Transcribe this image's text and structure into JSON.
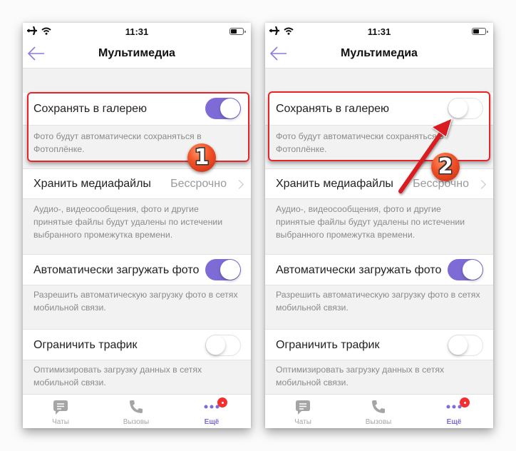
{
  "screens": [
    {
      "status": {
        "time": "11:31"
      },
      "nav": {
        "title": "Мультимедиа"
      },
      "settings": [
        {
          "label": "Сохранять в галерею",
          "toggle": true,
          "description": "Фото будут автоматически сохраняться в Фотоплёнке."
        },
        {
          "label": "Хранить медиафайлы",
          "value": "Бессрочно",
          "description": "Аудио-, видеосообщения, фото и другие принятые файлы будут удалены по истечении выбранного промежутка времени."
        },
        {
          "label": "Автоматически загружать фото",
          "toggle": true,
          "description": "Разрешить автоматическую загрузку фото в сетях мобильной связи."
        },
        {
          "label": "Ограничить трафик",
          "toggle": false,
          "description": "Оптимизировать загрузку данных в сетях мобильной связи."
        }
      ],
      "tabs": [
        {
          "label": "Чаты",
          "icon": "chat-bubble-icon"
        },
        {
          "label": "Вызовы",
          "icon": "phone-icon"
        },
        {
          "label": "Ещё",
          "icon": "more-dots-icon",
          "active": true,
          "badge": true
        }
      ],
      "annotation": {
        "step": "1"
      }
    },
    {
      "status": {
        "time": "11:31"
      },
      "nav": {
        "title": "Мультимедиа"
      },
      "settings": [
        {
          "label": "Сохранять в галерею",
          "toggle": false,
          "description": "Фото будут автоматически сохраняться в Фотоплёнке."
        },
        {
          "label": "Хранить медиафайлы",
          "value": "Бессрочно",
          "description": "Аудио-, видеосообщения, фото и другие принятые файлы будут удалены по истечении выбранного промежутка времени."
        },
        {
          "label": "Автоматически загружать фото",
          "toggle": true,
          "description": "Разрешить автоматическую загрузку фото в сетях мобильной связи."
        },
        {
          "label": "Ограничить трафик",
          "toggle": false,
          "description": "Оптимизировать загрузку данных в сетях мобильной связи."
        }
      ],
      "tabs": [
        {
          "label": "Чаты",
          "icon": "chat-bubble-icon"
        },
        {
          "label": "Вызовы",
          "icon": "phone-icon"
        },
        {
          "label": "Ещё",
          "icon": "more-dots-icon",
          "active": true,
          "badge": true
        }
      ],
      "annotation": {
        "step": "2"
      }
    }
  ],
  "colors": {
    "accent": "#7f6bd6",
    "highlight": "#e8232a",
    "badge": "#f52f2f"
  }
}
